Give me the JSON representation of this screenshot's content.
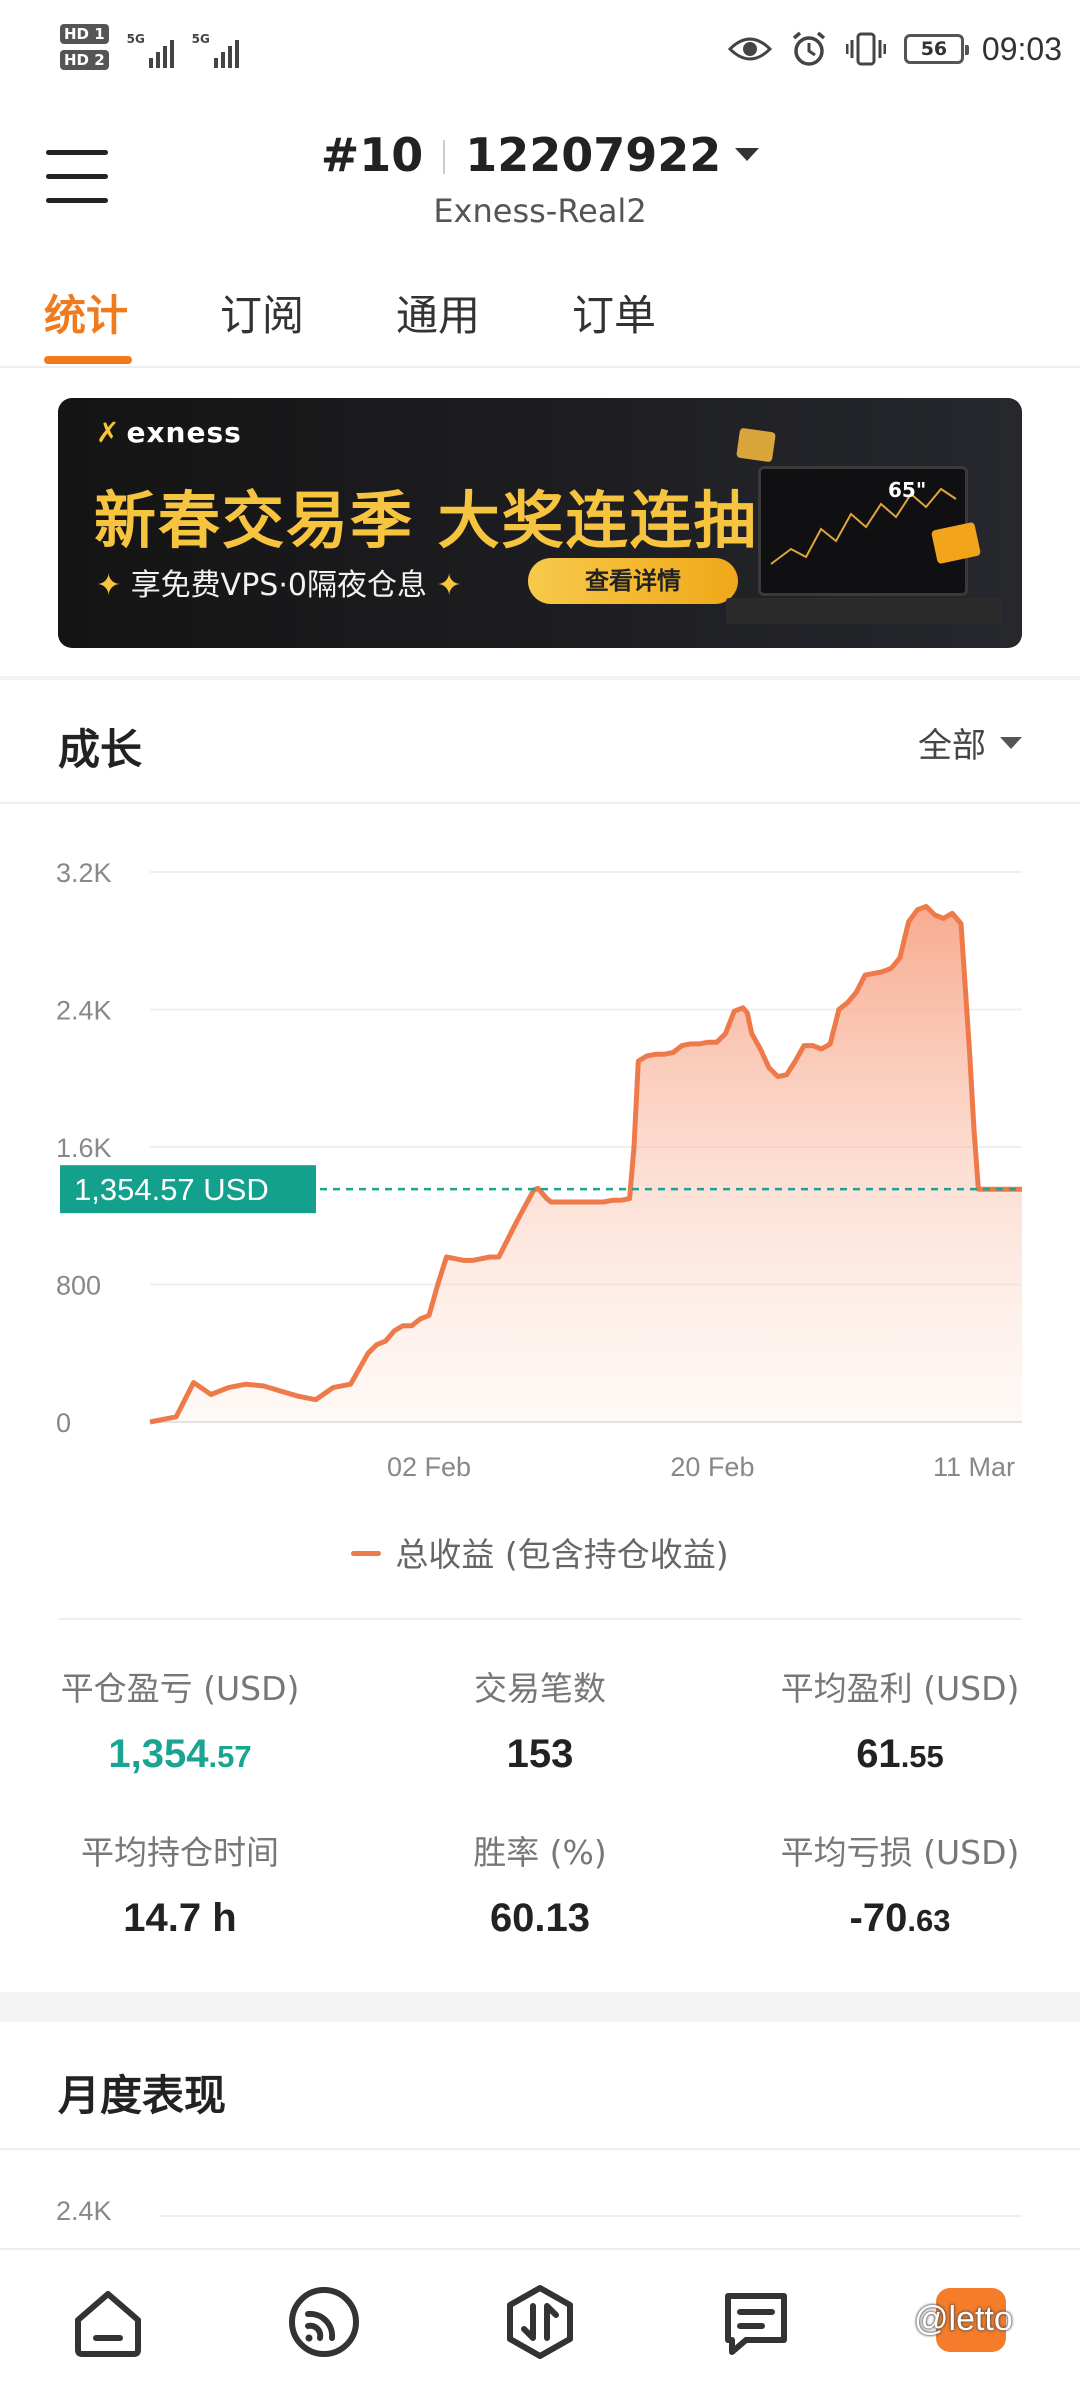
{
  "status_bar": {
    "hd_tags": [
      "HD 1",
      "HD 2"
    ],
    "net_labels": [
      "5G",
      "5G"
    ],
    "battery": "56",
    "time": "09:03",
    "icons": [
      "eye-icon",
      "alarm-icon",
      "vibrate-icon",
      "battery-icon"
    ]
  },
  "header": {
    "account_index": "#10",
    "account_number": "12207922",
    "server": "Exness-Real2"
  },
  "tabs": [
    {
      "label": "统计",
      "active": true
    },
    {
      "label": "订阅",
      "active": false
    },
    {
      "label": "通用",
      "active": false
    },
    {
      "label": "订单",
      "active": false
    }
  ],
  "banner": {
    "brand": "exness",
    "headline": "新春交易季 大奖连连抽",
    "subline": "享免费VPS·0隔夜仓息",
    "cta": "查看详情",
    "tv_badge": "65\"",
    "colors": {
      "gold": "#f7c440",
      "background": "#1a1a1c"
    }
  },
  "growth": {
    "title": "成长",
    "filter": "全部",
    "current_value_label": "1,354.57 USD",
    "legend": "总收益 (包含持仓收益)"
  },
  "chart_data": {
    "type": "area",
    "title": "",
    "xlabel": "",
    "ylabel": "",
    "ylim": [
      0,
      3200
    ],
    "yticks": [
      "0",
      "800",
      "1.6K",
      "2.4K",
      "3.2K"
    ],
    "xticks": [
      {
        "label": "02 Feb",
        "x": 0.32
      },
      {
        "label": "20 Feb",
        "x": 0.645
      },
      {
        "label": "11 Mar",
        "x": 0.945
      }
    ],
    "current_value": 1354.57,
    "series": [
      {
        "name": "总收益 (包含持仓收益)",
        "color": "#ee7a4a",
        "x": [
          0.0,
          0.03,
          0.05,
          0.07,
          0.09,
          0.11,
          0.13,
          0.15,
          0.17,
          0.19,
          0.21,
          0.23,
          0.25,
          0.26,
          0.27,
          0.28,
          0.29,
          0.3,
          0.31,
          0.32,
          0.33,
          0.34,
          0.35,
          0.36,
          0.37,
          0.38,
          0.39,
          0.4,
          0.42,
          0.44,
          0.445,
          0.455,
          0.46,
          0.47,
          0.48,
          0.49,
          0.5,
          0.51,
          0.52,
          0.53,
          0.54,
          0.55,
          0.555,
          0.56,
          0.57,
          0.58,
          0.59,
          0.6,
          0.61,
          0.62,
          0.63,
          0.64,
          0.65,
          0.66,
          0.67,
          0.68,
          0.685,
          0.69,
          0.7,
          0.71,
          0.72,
          0.73,
          0.74,
          0.75,
          0.76,
          0.77,
          0.78,
          0.79,
          0.8,
          0.81,
          0.82,
          0.83,
          0.84,
          0.85,
          0.86,
          0.87,
          0.88,
          0.89,
          0.9,
          0.91,
          0.92,
          0.93,
          0.94,
          0.945,
          0.95,
          0.96,
          0.97,
          0.98,
          1.0
        ],
        "values": [
          0,
          30,
          230,
          160,
          200,
          220,
          210,
          180,
          150,
          130,
          200,
          220,
          400,
          450,
          470,
          530,
          560,
          560,
          600,
          620,
          800,
          960,
          950,
          940,
          940,
          950,
          960,
          960,
          1160,
          1350,
          1360,
          1300,
          1280,
          1280,
          1280,
          1280,
          1280,
          1280,
          1280,
          1290,
          1290,
          1300,
          1600,
          2100,
          2130,
          2140,
          2140,
          2150,
          2190,
          2200,
          2200,
          2210,
          2210,
          2260,
          2390,
          2410,
          2380,
          2260,
          2170,
          2060,
          2010,
          2020,
          2100,
          2190,
          2190,
          2170,
          2200,
          2400,
          2440,
          2500,
          2600,
          2610,
          2620,
          2640,
          2700,
          2910,
          2980,
          3000,
          2950,
          2930,
          2960,
          2900,
          2140,
          1700,
          1354.57,
          1354.57,
          1354.57,
          1354.57,
          1354.57
        ]
      }
    ],
    "grid": true,
    "legend_position": "bottom"
  },
  "stats": [
    {
      "label": "平仓盈亏 (USD)",
      "int": "1,354",
      "dec": ".57",
      "style": "green"
    },
    {
      "label": "交易笔数",
      "int": "153",
      "dec": "",
      "style": "normal"
    },
    {
      "label": "平均盈利 (USD)",
      "int": "61",
      "dec": ".55",
      "style": "normal"
    },
    {
      "label": "平均持仓时间",
      "int": "14.7 h",
      "dec": "",
      "style": "normal"
    },
    {
      "label": "胜率 (%)",
      "int": "60.13",
      "dec": "",
      "style": "normal"
    },
    {
      "label": "平均亏损 (USD)",
      "int": "-70",
      "dec": ".63",
      "style": "normal"
    }
  ],
  "monthly": {
    "title": "月度表现",
    "first_tick": "2.4K"
  },
  "bottom_nav": {
    "items": [
      "home-icon",
      "signals-icon",
      "trade-icon",
      "chat-icon",
      "calendar-icon"
    ],
    "watermark": "@letto"
  }
}
